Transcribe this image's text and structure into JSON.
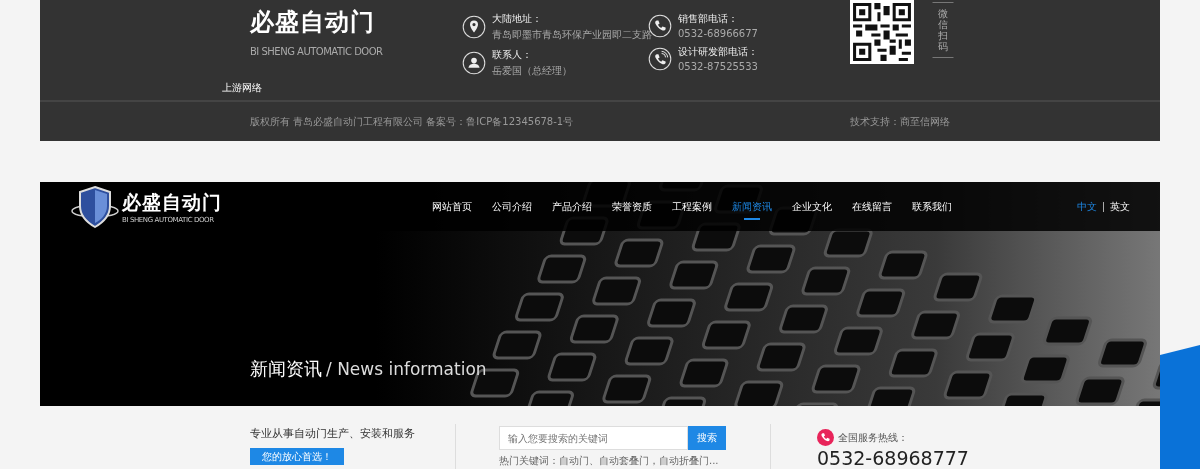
{
  "footer": {
    "logo": {
      "name": "必盛自动门",
      "subtitle": "BI SHENG AUTOMATIC DOOR"
    },
    "contacts": [
      {
        "kind": "address",
        "label": "大陆地址：",
        "value": "青岛即墨市青岛环保产业园即二支路"
      },
      {
        "kind": "person",
        "label": "联系人：",
        "value": "岳爱国（总经理）"
      },
      {
        "kind": "phone",
        "label": "销售部电话：",
        "value": "0532-68966677"
      },
      {
        "kind": "phone-ring",
        "label": "设计研发部电话：",
        "value": "0532-87525533"
      }
    ],
    "qr_caption": "微信扫码",
    "note": "上游网络",
    "copyright": "版权所有  青岛必盛自动门工程有限公司  备案号：鲁ICP备12345678-1号",
    "support": "技术支持：商至信网络"
  },
  "header": {
    "logo": {
      "name": "必盛自动门",
      "subtitle": "BI SHENG AUTOMATIC DOOR"
    },
    "nav": [
      {
        "label": "网站首页",
        "selected": false
      },
      {
        "label": "公司介绍",
        "selected": false
      },
      {
        "label": "产品介绍",
        "selected": false
      },
      {
        "label": "荣誉资质",
        "selected": false
      },
      {
        "label": "工程案例",
        "selected": false
      },
      {
        "label": "新闻资讯",
        "selected": true
      },
      {
        "label": "企业文化",
        "selected": false
      },
      {
        "label": "在线留言",
        "selected": false
      },
      {
        "label": "联系我们",
        "selected": false
      }
    ],
    "languages": [
      {
        "label": "中文",
        "selected": true
      },
      {
        "label": "英文",
        "selected": false
      }
    ]
  },
  "banner": {
    "title": "新闻资讯",
    "subtitle": "/ News information"
  },
  "info_bar": {
    "slogan": "专业从事自动门生产、安装和服务",
    "badge": "您的放心首选！",
    "search": {
      "placeholder": "输入您要搜索的关键词",
      "button": "搜索"
    },
    "hot_keywords": "热门关键词：自动门、自动套叠门，自动折叠门...",
    "hotline_label": "全国服务热线：",
    "hotline": "0532-68968777"
  }
}
